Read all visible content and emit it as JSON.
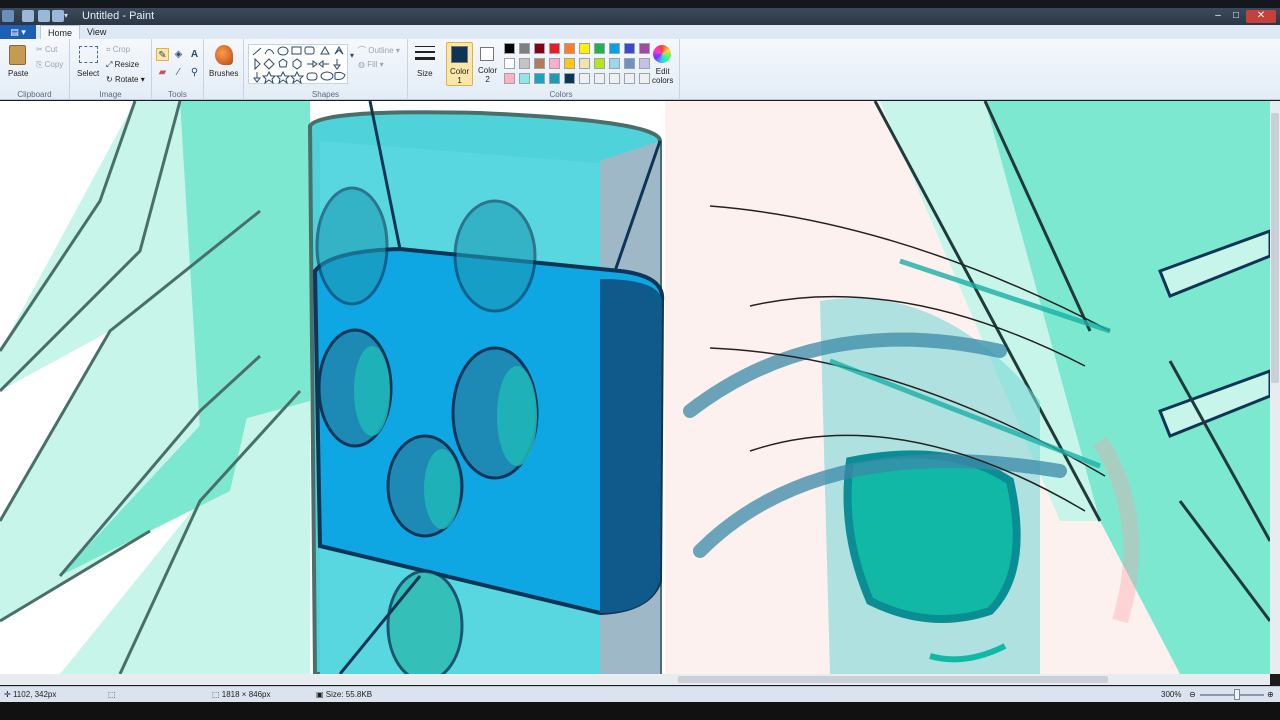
{
  "window": {
    "title": "Untitled - Paint",
    "minimize": "–",
    "maximize": "□",
    "close": "✕"
  },
  "tabs": {
    "file": "▤ ▾",
    "home": "Home",
    "view": "View"
  },
  "ribbon": {
    "clipboard": {
      "label": "Clipboard",
      "paste": "Paste",
      "cut": "Cut",
      "copy": "Copy"
    },
    "image": {
      "label": "Image",
      "select": "Select",
      "crop": "Crop",
      "resize": "Resize",
      "rotate": "Rotate"
    },
    "tools": {
      "label": "Tools"
    },
    "brushes": {
      "label": "Brushes"
    },
    "shapes": {
      "label": "Shapes",
      "outline": "Outline",
      "fill": "Fill"
    },
    "size": {
      "label": "Size"
    },
    "color1": {
      "label": "Color\n1",
      "value": "#0f3556"
    },
    "color2": {
      "label": "Color\n2",
      "value": "#ffffff"
    },
    "colors": {
      "label": "Colors",
      "edit": "Edit\ncolors"
    }
  },
  "palette": [
    "#000000",
    "#7f7f7f",
    "#880015",
    "#ed1c24",
    "#ff7f27",
    "#fff200",
    "#22b14c",
    "#00a2e8",
    "#3f48cc",
    "#a349a4",
    "#ffffff",
    "#c3c3c3",
    "#b97a57",
    "#ffaec9",
    "#ffc90e",
    "#efe4b0",
    "#b5e61d",
    "#99d9ea",
    "#7092be",
    "#c8bfe7",
    "#ffb1c1",
    "#8fe7e7",
    "#1da1c1",
    "#1d9ab6",
    "#0f3556",
    "#f0f0f0",
    "#f0f0f0",
    "#f0f0f0",
    "#f0f0f0",
    "#f0f0f0"
  ],
  "status": {
    "cursor": "1102, 342px",
    "dimensions": "1818 × 846px",
    "size": "Size: 55.8KB",
    "zoom": "300%"
  },
  "canvas_colors": {
    "hair": "#7de8d0",
    "hair_light": "#c7f5ea",
    "blue": "#0ea6e3",
    "navy": "#0f3556",
    "cyan": "#4fd2d9",
    "iris": "#12b8a6",
    "skin": "#fdf1ef"
  }
}
